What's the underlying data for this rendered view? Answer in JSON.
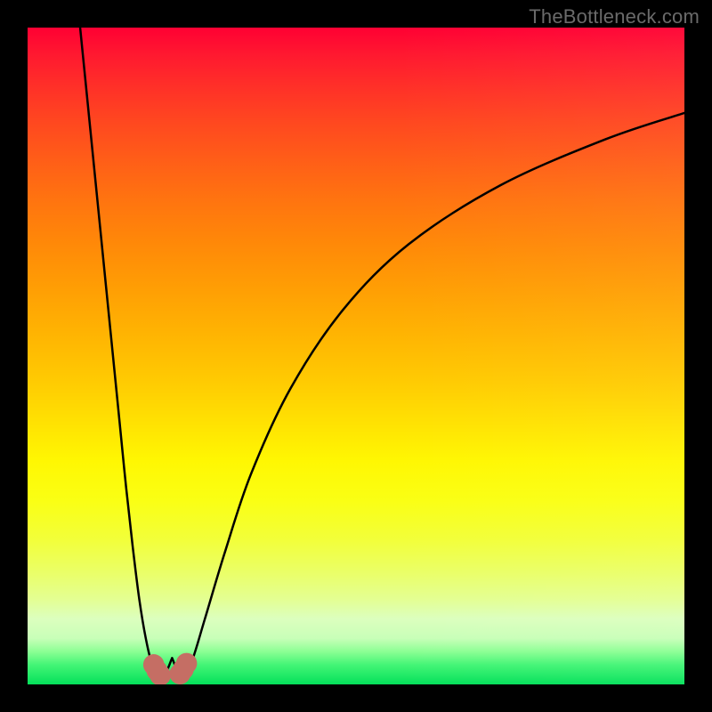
{
  "watermark": "TheBottleneck.com",
  "chart_data": {
    "type": "line",
    "title": "",
    "xlabel": "",
    "ylabel": "",
    "xlim": [
      0,
      100
    ],
    "ylim": [
      0,
      100
    ],
    "gradient_stops": [
      {
        "pos": 0,
        "color": "#ff0033"
      },
      {
        "pos": 33,
        "color": "#ff8908"
      },
      {
        "pos": 66,
        "color": "#fff702"
      },
      {
        "pos": 90,
        "color": "#dcffbe"
      },
      {
        "pos": 100,
        "color": "#04e05a"
      }
    ],
    "series": [
      {
        "name": "curve-left",
        "x": [
          8,
          10,
          12,
          14,
          15,
          16,
          17,
          18,
          19,
          20.5,
          22
        ],
        "values": [
          100,
          80,
          60,
          40,
          30,
          21,
          13,
          7,
          3,
          1,
          4
        ]
      },
      {
        "name": "curve-right",
        "x": [
          22,
          23.5,
          25,
          27,
          30,
          34,
          40,
          48,
          58,
          72,
          88,
          100
        ],
        "values": [
          4,
          1,
          3.5,
          10,
          20,
          32,
          45,
          57,
          67,
          76,
          83,
          87
        ]
      }
    ],
    "markers": [
      {
        "name": "left-nub-top",
        "x": 19.2,
        "y": 3.0
      },
      {
        "name": "left-nub-mid",
        "x": 19.7,
        "y": 2.1
      },
      {
        "name": "left-nub-bot",
        "x": 20.2,
        "y": 1.4
      },
      {
        "name": "right-nub-top",
        "x": 23.2,
        "y": 1.6
      },
      {
        "name": "right-nub-mid",
        "x": 23.7,
        "y": 2.3
      },
      {
        "name": "right-nub-bot",
        "x": 24.2,
        "y": 3.2
      }
    ],
    "marker_color": "#c56e64",
    "marker_radius": 1.6
  }
}
